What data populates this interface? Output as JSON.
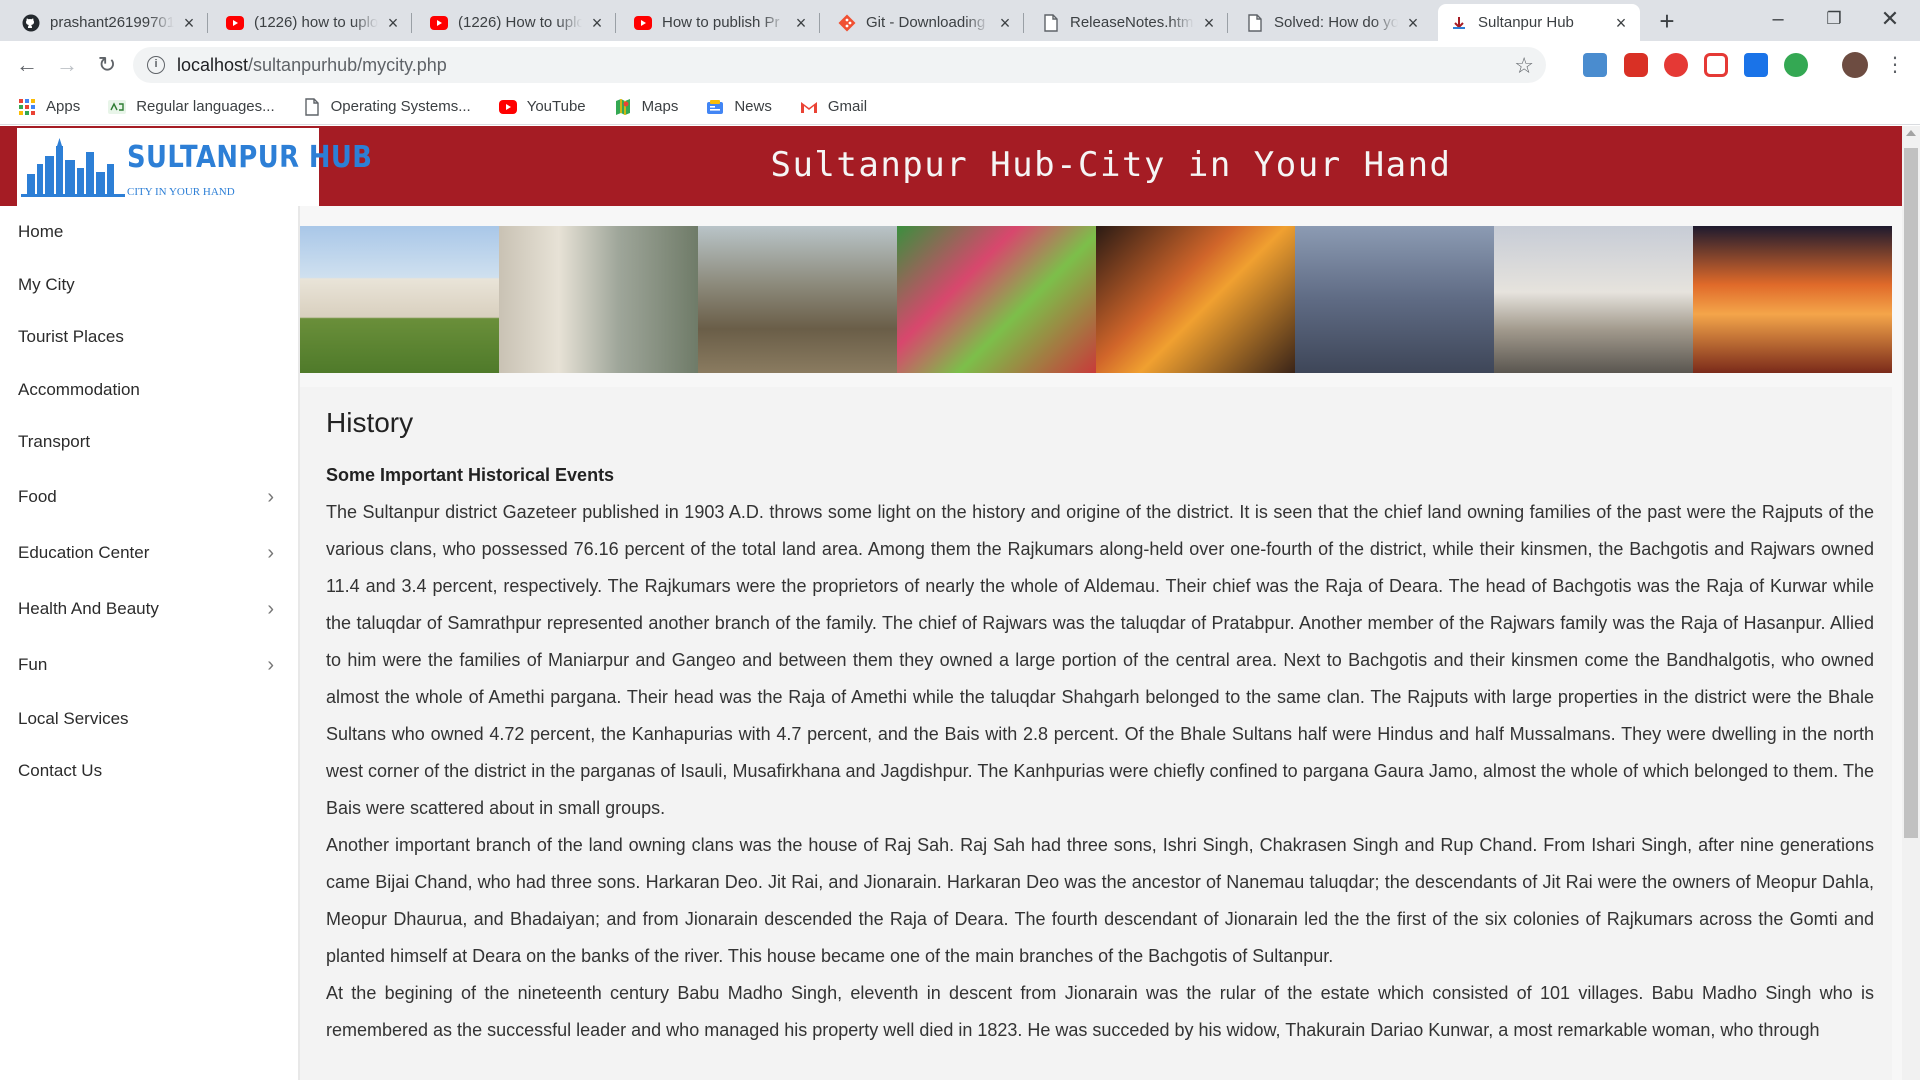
{
  "browser": {
    "tabs": [
      {
        "title": "prashant26199701",
        "icon": "github-icon"
      },
      {
        "title": "(1226) how to uplo",
        "icon": "youtube-icon"
      },
      {
        "title": "(1226) How to uplo",
        "icon": "youtube-icon"
      },
      {
        "title": "How to publish Pr",
        "icon": "youtube-icon"
      },
      {
        "title": "Git - Downloading",
        "icon": "git-icon"
      },
      {
        "title": "ReleaseNotes.html",
        "icon": "document-icon"
      },
      {
        "title": "Solved: How do yo",
        "icon": "document-icon"
      },
      {
        "title": "Sultanpur Hub",
        "icon": "site-favicon",
        "active": true
      }
    ],
    "url_host": "localhost",
    "url_path": "/sultanpurhub/mycity.php",
    "bookmarks": [
      {
        "label": "Apps",
        "icon": "apps-grid-icon"
      },
      {
        "label": "Regular languages...",
        "icon": "bookmark-site-icon"
      },
      {
        "label": "Operating Systems...",
        "icon": "document-icon"
      },
      {
        "label": "YouTube",
        "icon": "youtube-icon"
      },
      {
        "label": "Maps",
        "icon": "maps-icon"
      },
      {
        "label": "News",
        "icon": "news-icon"
      },
      {
        "label": "Gmail",
        "icon": "gmail-icon"
      }
    ]
  },
  "site": {
    "logo_title": "SULTANPUR HUB",
    "logo_tagline": "CITY IN YOUR HAND",
    "header_title": "Sultanpur Hub-City in Your Hand",
    "brand_color": "#a51c24",
    "logo_color": "#2d7fd6"
  },
  "sidebar": {
    "items": [
      {
        "label": "Home",
        "has_submenu": false
      },
      {
        "label": "My City",
        "has_submenu": false
      },
      {
        "label": "Tourist Places",
        "has_submenu": false
      },
      {
        "label": "Accommodation",
        "has_submenu": false
      },
      {
        "label": "Transport",
        "has_submenu": false
      },
      {
        "label": "Food",
        "has_submenu": true
      },
      {
        "label": "Education Center",
        "has_submenu": true
      },
      {
        "label": "Health And Beauty",
        "has_submenu": true
      },
      {
        "label": "Fun",
        "has_submenu": true
      },
      {
        "label": "Local Services",
        "has_submenu": false
      },
      {
        "label": "Contact Us",
        "has_submenu": false
      }
    ]
  },
  "article": {
    "heading": "History",
    "subheading": "Some Important Historical Events",
    "paragraphs": [
      "The Sultanpur district Gazeteer published in 1903 A.D. throws some light on the history and origine of the district. It is seen that the chief land owning families of the past were the Rajputs of the various clans, who possessed 76.16 percent of the total land area. Among them the Rajkumars along-held over one-fourth of the district, while their kinsmen, the Bachgotis and Rajwars owned 11.4 and 3.4 percent, respectively. The Rajkumars were the proprietors of nearly the whole of Aldemau. Their chief was the Raja of Deara. The head of Bachgotis was the Raja of Kurwar while the taluqdar of Samrathpur represented another branch of the family. The chief of Rajwars was the taluqdar of Pratabpur. Another member of the Rajwars family was the Raja of Hasanpur. Allied to him were the families of Maniarpur and Gangeo and between them they owned a large portion of the central area. Next to Bachgotis and their kinsmen come the Bandhalgotis, who owned almost the whole of Amethi pargana. Their head was the Raja of Amethi while the taluqdar Shahgarh belonged to the same clan. The Rajputs with large properties in the district were the Bhale Sultans who owned 4.72 percent, the Kanhapurias with 4.7 percent, and the Bais with 2.8 percent. Of the Bhale Sultans half were Hindus and half Mussalmans. They were dwelling in the north west corner of the district in the parganas of Isauli, Musafirkhana and Jagdishpur. The Kanhpurias were chiefly confined to pargana Gaura Jamo, almost the whole of which belonged to them. The Bais were scattered about in small groups.",
      "Another important branch of the land owning clans was the house of Raj Sah. Raj Sah had three sons, Ishri Singh, Chakrasen Singh and Rup Chand. From Ishari Singh, after nine generations came Bijai Chand, who had three sons. Harkaran Deo. Jit Rai, and Jionarain. Harkaran Deo was the ancestor of Nanemau taluqdar; the descendants of Jit Rai were the owners of Meopur Dahla, Meopur Dhaurua, and Bhadaiyan; and from Jionarain descended the Raja of Deara. The fourth descendant of Jionarain led the the first of the six colonies of Rajkumars across the Gomti and planted himself at Deara on the banks of the river. This house became one of the main branches of the Bachgotis of Sultanpur.",
      "At the begining of the nineteenth century Babu Madho Singh, eleventh in descent from Jionarain was the rular of the estate which consisted of 101 villages. Babu Madho Singh who is remembered as the successful leader and who managed his property well died in 1823. He was succeded by his widow, Thakurain Dariao Kunwar, a most remarkable woman, who through"
    ]
  }
}
